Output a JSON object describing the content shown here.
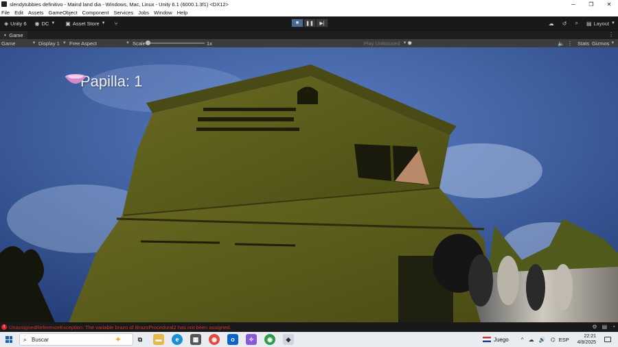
{
  "window": {
    "title": "slendytubbies  definitivo - Maind land dia - Windows, Mac, Linux - Unity 6.1 (6000.1.3f1) <DX12>",
    "minimize": "─",
    "restore": "❐",
    "close": "✕"
  },
  "menu": [
    "File",
    "Edit",
    "Assets",
    "GameObject",
    "Component",
    "Services",
    "Jobs",
    "Window",
    "Help"
  ],
  "toolbar": {
    "unity_label": "Unity 6",
    "account_label": "DC",
    "asset_store_label": "Asset Store",
    "layout_label": "Layout"
  },
  "tab": {
    "label": "Game"
  },
  "gamebar": {
    "mode": "Game",
    "display": "Display 1",
    "aspect": "Free Aspect",
    "scale_label": "Scale",
    "scale_value": "1x",
    "play_mode": "Play Unfocused",
    "stats": "Stats",
    "gizmos": "Gizmos"
  },
  "hud": {
    "text": "Papilla: 1"
  },
  "status": {
    "error_text": "UnassignedReferenceException: The variable brazo of BrazoProcedural2 has not been assigned."
  },
  "taskbar": {
    "search_placeholder": "Buscar",
    "game_label": "Juego",
    "language": "ESP",
    "time": "22:21",
    "date": "4/8/2025"
  },
  "colors": {
    "editor_bg": "#191919",
    "error": "#c8352f",
    "play_active": "#4a6a94",
    "house": "#5a5a1c",
    "sky": "#3b5d9e"
  }
}
